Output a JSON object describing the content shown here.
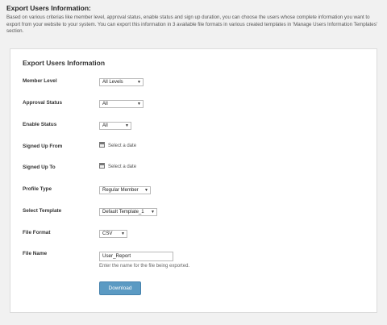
{
  "header": {
    "title": "Export Users Information:",
    "description": "Based on various criterias like member level, approval status, enable status and sign up duration, you can choose the users whose complete information you want to export from your website to your system. You can export this information in 3 available file formats in various created templates in 'Manage Users Information Templates' section."
  },
  "panel": {
    "title": "Export Users Information",
    "member_level": {
      "label": "Member Level",
      "value": "All Levels"
    },
    "approval_status": {
      "label": "Approval Status",
      "value": "All"
    },
    "enable_status": {
      "label": "Enable Status",
      "value": "All"
    },
    "signed_up_from": {
      "label": "Signed Up From",
      "placeholder": "Select a date"
    },
    "signed_up_to": {
      "label": "Signed Up To",
      "placeholder": "Select a date"
    },
    "profile_type": {
      "label": "Profile Type",
      "value": "Regular Member"
    },
    "select_template": {
      "label": "Select Template",
      "value": "Default Template_1"
    },
    "file_format": {
      "label": "File Format",
      "value": "CSV"
    },
    "file_name": {
      "label": "File Name",
      "value": "User_Report",
      "help": "Enter the name for the file being exported."
    },
    "download_label": "Download"
  },
  "colors": {
    "button": "#5b9ac3",
    "background": "#f1f1f1"
  },
  "icons": [
    "calendar-icon",
    "chevron-down-icon"
  ]
}
